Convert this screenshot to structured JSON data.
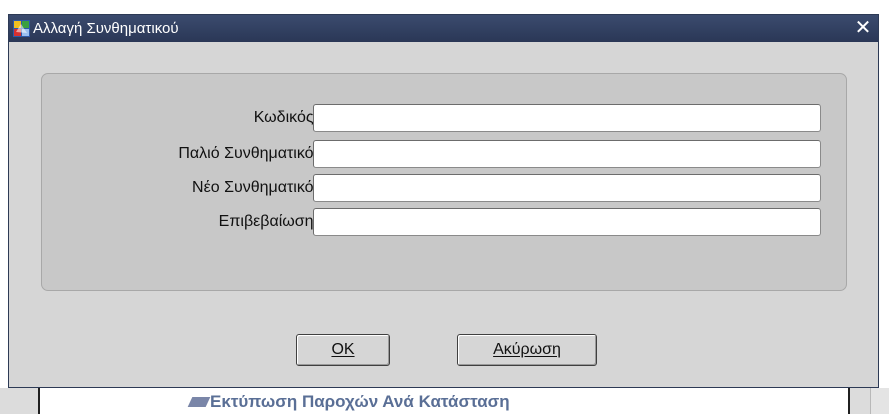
{
  "window": {
    "title": "Αλλαγή Συνθηματικού",
    "close_glyph": "✕"
  },
  "form": {
    "fields": [
      {
        "label": "Κωδικός:",
        "value": "",
        "placeholder": ""
      },
      {
        "label": "Παλιό Συνθηματικό:",
        "value": "",
        "placeholder": ""
      },
      {
        "label": "Νέο Συνθηματικό:",
        "value": "",
        "placeholder": ""
      },
      {
        "label": "Επιβεβαίωση:",
        "value": "",
        "placeholder": ""
      }
    ]
  },
  "buttons": {
    "ok_label": "OK",
    "cancel_label": "Ακύρωση"
  },
  "background": {
    "partial_text": "Εκτύπωση Παροχών Ανά Κατάσταση"
  },
  "colors": {
    "titlebar": "#2f3d5e",
    "dialog_bg": "#d6d6d6",
    "panel_bg": "#c8c8c8"
  }
}
